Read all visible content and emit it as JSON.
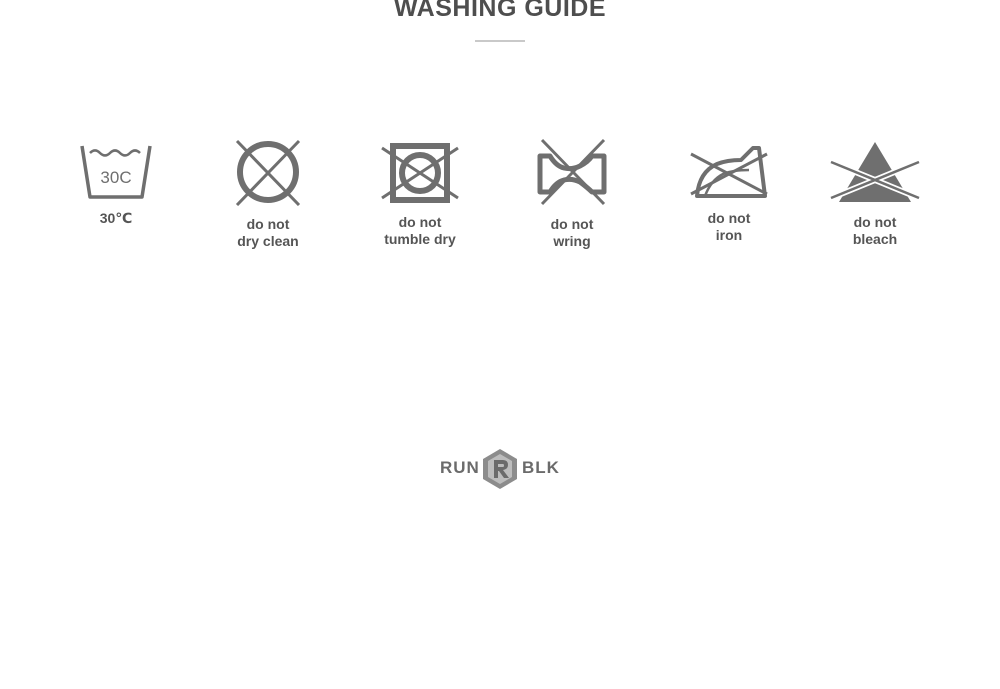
{
  "title": "WASHING GUIDE",
  "symbols": [
    {
      "icon": "wash-30-icon",
      "inner_text": "30C",
      "label_line1": "30℃",
      "label_line2": ""
    },
    {
      "icon": "do-not-dry-clean-icon",
      "label_line1": "do not",
      "label_line2": "dry clean"
    },
    {
      "icon": "do-not-tumble-dry-icon",
      "label_line1": "do not",
      "label_line2": "tumble dry"
    },
    {
      "icon": "do-not-wring-icon",
      "label_line1": "do not",
      "label_line2": "wring"
    },
    {
      "icon": "do-not-iron-icon",
      "label_line1": "do not",
      "label_line2": "iron"
    },
    {
      "icon": "do-not-bleach-icon",
      "label_line1": "do not",
      "label_line2": "bleach"
    }
  ],
  "brand": {
    "left_text": "RUN",
    "right_text": "BLK"
  },
  "colors": {
    "icon": "#6f6f6f",
    "text": "#555555",
    "rule": "#c9c9c9"
  }
}
